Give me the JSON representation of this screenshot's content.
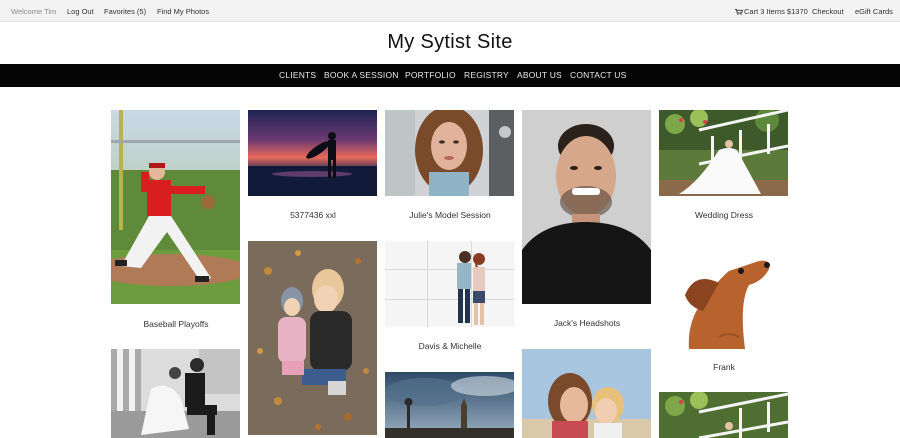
{
  "topbar": {
    "welcome": "Welcome Tim",
    "logout": "Log Out",
    "favorites": "Favorites (5)",
    "find_photos": "Find My Photos",
    "cart": "Cart 3 Items $1370",
    "checkout": "Checkout",
    "egift": "eGift Cards"
  },
  "site": {
    "title": "My Sytist Site"
  },
  "nav": [
    "CLIENTS",
    "BOOK A SESSION",
    "PORTFOLIO",
    "REGISTRY",
    "ABOUT US",
    "CONTACT US"
  ],
  "gallery": [
    {
      "caption": "Baseball Playoffs"
    },
    {
      "caption": "5377436 xxl"
    },
    {
      "caption": "Julie's Model Session"
    },
    {
      "caption": "Jack's Headshots"
    },
    {
      "caption": "Wedding Dress"
    },
    {
      "caption": "Davis & Michelle"
    },
    {
      "caption": "Frank"
    }
  ],
  "icons": {
    "cart": "cart-icon"
  },
  "colors": {
    "navbar_bg": "#050505",
    "topbar_bg": "#f3f3f3"
  }
}
